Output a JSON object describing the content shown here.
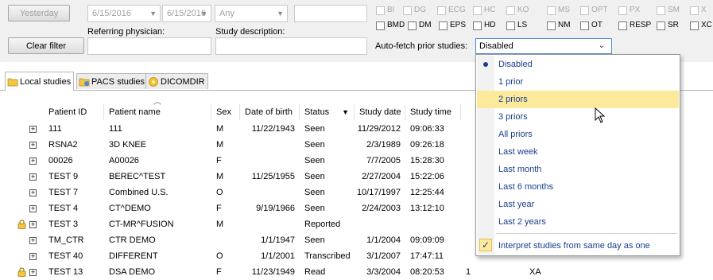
{
  "filter": {
    "yesterday_button": "Yesterday",
    "date_from": "6/15/2016",
    "date_to": "6/15/2016",
    "sex_select": "Any",
    "clear_filter_button": "Clear filter",
    "referring_physician_label": "Referring physician:",
    "study_description_label": "Study description:",
    "modalities_row1": [
      "BI",
      "DG",
      "ECG",
      "HC",
      "KO",
      "MS",
      "OPT",
      "PX",
      "SM",
      "X"
    ],
    "modalities_row2": [
      "BMD",
      "DM",
      "EPS",
      "HD",
      "LS",
      "NM",
      "OT",
      "RESP",
      "SR",
      "XC"
    ],
    "auto_fetch_label": "Auto-fetch prior studies:",
    "auto_fetch_value": "Disabled"
  },
  "tabs": [
    "Local studies",
    "PACS studies",
    "DICOMDIR"
  ],
  "columns": [
    "Patient ID",
    "Patient name",
    "Sex",
    "Date of birth",
    "Status",
    "Study date",
    "Study time"
  ],
  "rows": [
    {
      "id": "111",
      "name": "111",
      "sex": "M",
      "dob": "11/22/1943",
      "status": "Seen",
      "date": "11/29/2012",
      "time": "09:06:33",
      "extra1": "",
      "extra2": "",
      "locked": false
    },
    {
      "id": "RSNA2",
      "name": "3D KNEE",
      "sex": "M",
      "dob": "",
      "status": "Seen",
      "date": "2/3/1989",
      "time": "09:26:18",
      "extra1": "",
      "extra2": "",
      "locked": false
    },
    {
      "id": "00026",
      "name": "A00026",
      "sex": "F",
      "dob": "",
      "status": "Seen",
      "date": "7/7/2005",
      "time": "15:28:30",
      "extra1": "",
      "extra2": "",
      "locked": false
    },
    {
      "id": "TEST 9",
      "name": "BEREC^TEST",
      "sex": "M",
      "dob": "11/25/1955",
      "status": "Seen",
      "date": "2/27/2004",
      "time": "15:22:06",
      "extra1": "",
      "extra2": "",
      "locked": false
    },
    {
      "id": "TEST 7",
      "name": "Combined U.S.",
      "sex": "O",
      "dob": "",
      "status": "Seen",
      "date": "10/17/1997",
      "time": "12:25:44",
      "extra1": "",
      "extra2": "",
      "locked": false
    },
    {
      "id": "TEST 4",
      "name": "CT^DEMO",
      "sex": "F",
      "dob": "9/19/1966",
      "status": "Seen",
      "date": "2/24/2003",
      "time": "13:12:10",
      "extra1": "",
      "extra2": "",
      "locked": false
    },
    {
      "id": "TEST 3",
      "name": "CT-MR^FUSION",
      "sex": "M",
      "dob": "",
      "status": "Reported",
      "date": "",
      "time": "",
      "extra1": "",
      "extra2": "",
      "locked": true
    },
    {
      "id": "TM_CTR",
      "name": "CTR DEMO",
      "sex": "",
      "dob": "1/1/1947",
      "status": "Seen",
      "date": "1/1/2004",
      "time": "09:09:09",
      "extra1": "",
      "extra2": "",
      "locked": false
    },
    {
      "id": "TEST 40",
      "name": "DIFFERENT",
      "sex": "O",
      "dob": "1/1/2001",
      "status": "Transcribed",
      "date": "3/1/2007",
      "time": "17:47:11",
      "extra1": "",
      "extra2": "",
      "locked": false
    },
    {
      "id": "TEST 13",
      "name": "DSA DEMO",
      "sex": "F",
      "dob": "11/23/1949",
      "status": "Read",
      "date": "3/3/2004",
      "time": "08:20:53",
      "extra1": "1",
      "extra2": "XA",
      "locked": true
    }
  ],
  "dropdown": {
    "options": [
      "Disabled",
      "1 prior",
      "2 priors",
      "3 priors",
      "All priors",
      "Last week",
      "Last month",
      "Last 6 months",
      "Last year",
      "Last 2 years"
    ],
    "selected_index": 0,
    "highlighted_index": 2,
    "interpret_same_day": "Interpret studies from same day as one"
  }
}
